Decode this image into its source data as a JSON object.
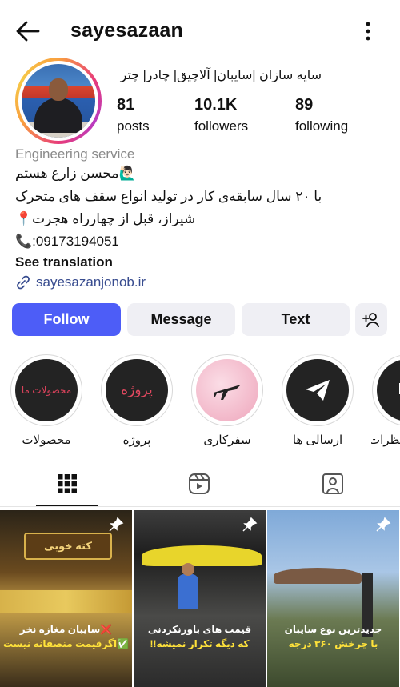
{
  "header": {
    "username": "sayesazaan",
    "back_icon": "arrow-left-icon",
    "menu_icon": "vertical-dots-icon"
  },
  "profile": {
    "full_name": "سایه سازان |سایبان| آلاچیق| چادر| چتر",
    "stats": {
      "posts_count": "81",
      "posts_label": "posts",
      "followers_count": "10.1K",
      "followers_label": "followers",
      "following_count": "89",
      "following_label": "following"
    },
    "category": "Engineering service",
    "bio": {
      "line1": "🙋🏻‍♂️محسن زارع هستم",
      "line2": "با ۲۰ سال سابقه‌ی کار در تولید انواع سقف های متحرک",
      "line3": "شیراز، قبل از چهارراه هجرت📍",
      "line4": "📞:09173194051"
    },
    "see_translation": "See translation",
    "link": "sayesazanjonob.ir"
  },
  "actions": {
    "follow": "Follow",
    "message": "Message",
    "text": "Text",
    "add_user_icon": "person-plus-icon",
    "accent": "#4d5df7"
  },
  "highlights": [
    {
      "label": "محصولات",
      "cover_text": "محصولات ما"
    },
    {
      "label": "پروژه",
      "cover_text": "پروژه"
    },
    {
      "label": "سفرکاری",
      "cover_text": ""
    },
    {
      "label": "ارسالی ها",
      "cover_text": ""
    },
    {
      "label": "نظرات مشتری ها",
      "cover_text": ""
    }
  ],
  "tabs": [
    {
      "name": "posts",
      "icon": "grid-icon",
      "active": true
    },
    {
      "name": "reels",
      "icon": "reels-icon",
      "active": false
    },
    {
      "name": "tagged",
      "icon": "tagged-person-icon",
      "active": false
    }
  ],
  "posts": [
    {
      "caption_line1": "❌سایبان مغازه نخر",
      "caption_line2": "✅اگرقیمت منصفانه نیست",
      "sign_text": "کته خوبی",
      "pinned": true
    },
    {
      "caption_line1": "قیمت های باورنکردنی",
      "caption_line2": "که دیگه تکرار نمیشه!!",
      "pinned": true
    },
    {
      "caption_line1": "جدیدترین نوع سایبان",
      "caption_line2": "با چرخش ۳۶۰ درجه",
      "pinned": true
    }
  ]
}
